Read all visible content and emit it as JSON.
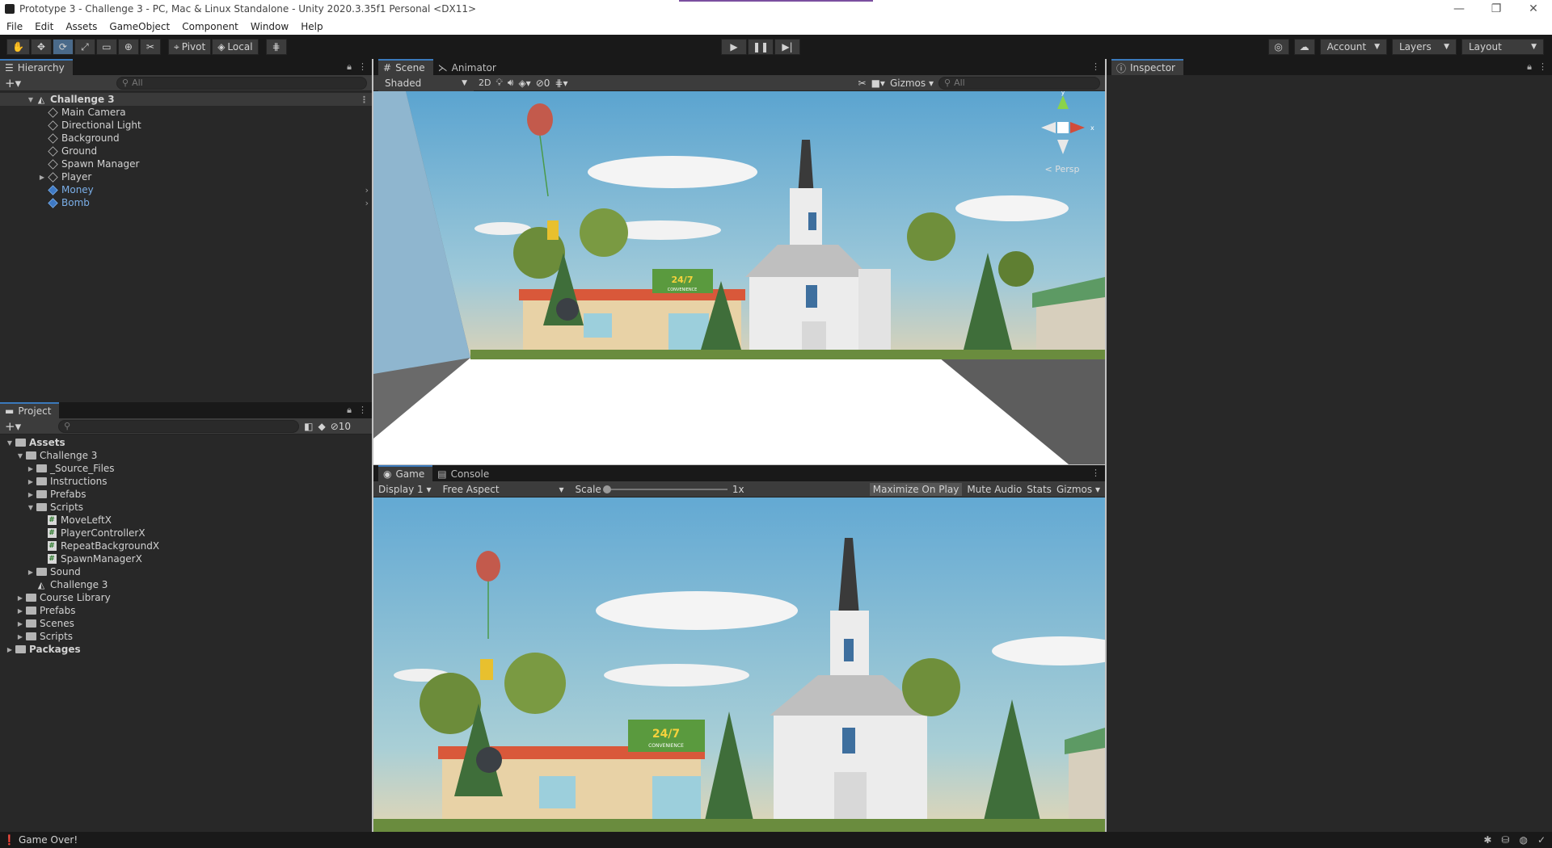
{
  "window": {
    "title": "Prototype 3 - Challenge 3 - PC, Mac & Linux Standalone - Unity 2020.3.35f1 Personal <DX11>",
    "minimize": "—",
    "maximize": "❐",
    "close": "✕"
  },
  "menu": [
    "File",
    "Edit",
    "Assets",
    "GameObject",
    "Component",
    "Window",
    "Help"
  ],
  "toolbar": {
    "pivot": "Pivot",
    "local": "Local",
    "account": "Account",
    "layers": "Layers",
    "layout": "Layout"
  },
  "hierarchy": {
    "tab": "Hierarchy",
    "search_placeholder": "All",
    "scene": "Challenge 3",
    "items": [
      {
        "label": "Main Camera",
        "type": "object"
      },
      {
        "label": "Directional Light",
        "type": "object"
      },
      {
        "label": "Background",
        "type": "object"
      },
      {
        "label": "Ground",
        "type": "object"
      },
      {
        "label": "Spawn Manager",
        "type": "object"
      },
      {
        "label": "Player",
        "type": "object"
      },
      {
        "label": "Money",
        "type": "prefab"
      },
      {
        "label": "Bomb",
        "type": "prefab"
      }
    ]
  },
  "project": {
    "tab": "Project",
    "hidden_count": "10",
    "items": [
      {
        "label": "Assets",
        "kind": "folder",
        "depth": 0,
        "expanded": true,
        "bold": true
      },
      {
        "label": "Challenge 3",
        "kind": "folder",
        "depth": 1,
        "expanded": true
      },
      {
        "label": "_Source_Files",
        "kind": "folder",
        "depth": 2,
        "expanded": false
      },
      {
        "label": "Instructions",
        "kind": "folder",
        "depth": 2,
        "expanded": false
      },
      {
        "label": "Prefabs",
        "kind": "folder",
        "depth": 2,
        "expanded": false
      },
      {
        "label": "Scripts",
        "kind": "folder",
        "depth": 2,
        "expanded": true
      },
      {
        "label": "MoveLeftX",
        "kind": "script",
        "depth": 3
      },
      {
        "label": "PlayerControllerX",
        "kind": "script",
        "depth": 3
      },
      {
        "label": "RepeatBackgroundX",
        "kind": "script",
        "depth": 3
      },
      {
        "label": "SpawnManagerX",
        "kind": "script",
        "depth": 3
      },
      {
        "label": "Sound",
        "kind": "folder",
        "depth": 2,
        "expanded": false
      },
      {
        "label": "Challenge 3",
        "kind": "scene",
        "depth": 2
      },
      {
        "label": "Course Library",
        "kind": "folder",
        "depth": 1,
        "expanded": false
      },
      {
        "label": "Prefabs",
        "kind": "folder",
        "depth": 1,
        "expanded": false
      },
      {
        "label": "Scenes",
        "kind": "folder",
        "depth": 1,
        "expanded": false
      },
      {
        "label": "Scripts",
        "kind": "folder",
        "depth": 1,
        "expanded": false
      },
      {
        "label": "Packages",
        "kind": "folder",
        "depth": 0,
        "expanded": false,
        "bold": true
      }
    ]
  },
  "scene": {
    "tab_scene": "Scene",
    "tab_animator": "Animator",
    "shading": "Shaded",
    "mode_2d": "2D",
    "hidden_count": "0",
    "gizmos": "Gizmos",
    "search_placeholder": "All",
    "persp": "< Persp",
    "sign_text": "24/7",
    "sign_sub": "CONVENIENCE"
  },
  "game": {
    "tab_game": "Game",
    "tab_console": "Console",
    "display": "Display 1",
    "aspect": "Free Aspect",
    "scale_label": "Scale",
    "scale_value": "1x",
    "maximize": "Maximize On Play",
    "mute": "Mute Audio",
    "stats": "Stats",
    "gizmos": "Gizmos"
  },
  "inspector": {
    "tab": "Inspector"
  },
  "status": {
    "message": "Game Over!"
  },
  "colors": {
    "accent": "#3a79bb",
    "sky": "#6aaed6",
    "prefab": "#7bafe8"
  }
}
